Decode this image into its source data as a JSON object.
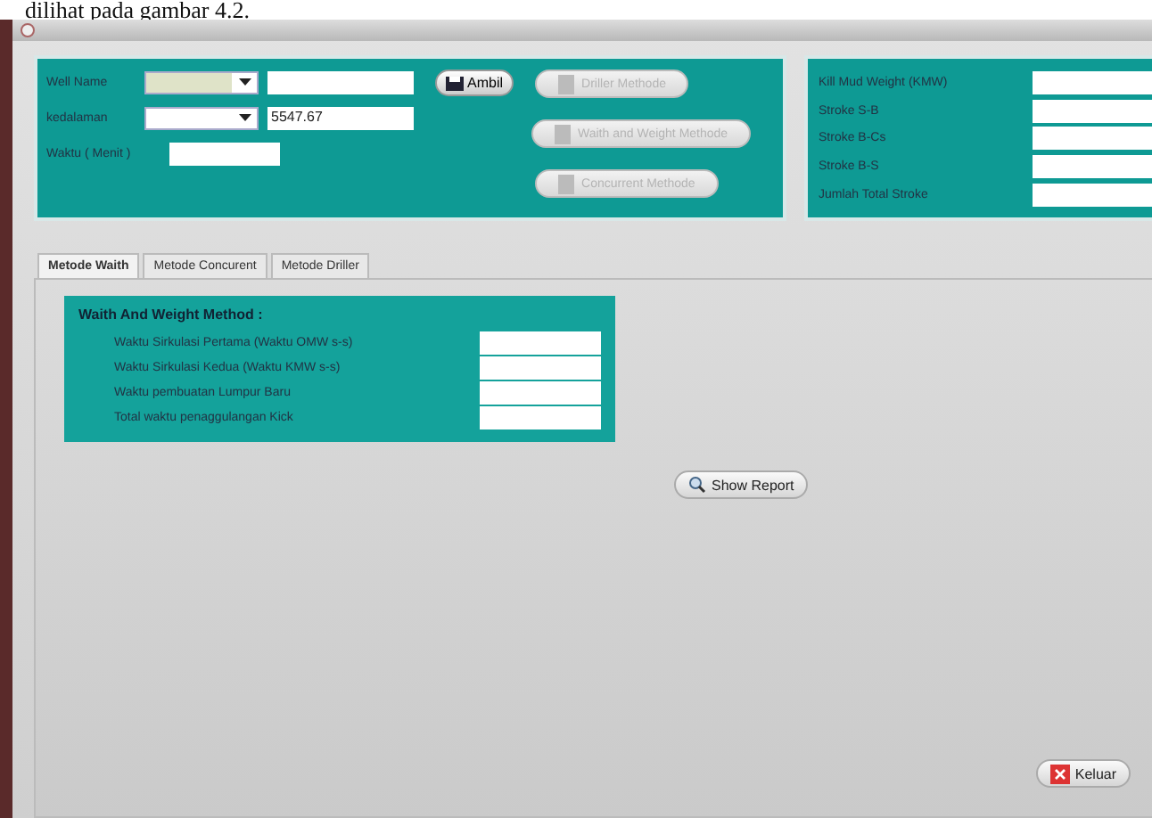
{
  "caption": "dilihat pada gambar 4.2.",
  "input_panel": {
    "rows": [
      {
        "label": "Well Name",
        "kind": "combo",
        "highlighted": true
      },
      {
        "label": "kedalaman",
        "kind": "combo",
        "highlighted": false,
        "value": "5547.67"
      },
      {
        "label": "Waktu ( Menit )",
        "kind": "text"
      }
    ],
    "ambil_button": "Ambil",
    "method_buttons": [
      {
        "label": "Driller Methode",
        "disabled": true
      },
      {
        "label": "Waith and Weight Methode",
        "disabled": true
      },
      {
        "label": "Concurrent Methode",
        "disabled": true
      }
    ]
  },
  "stroke_panel": {
    "rows": [
      "Kill Mud Weight (KMW)",
      "Stroke S-B",
      "Stroke B-Cs",
      "Stroke B-S",
      "Jumlah Total Stroke"
    ]
  },
  "tabs": [
    {
      "label": "Metode Waith",
      "selected": true
    },
    {
      "label": "Metode Concurent",
      "selected": false
    },
    {
      "label": "Metode Driller",
      "selected": false
    }
  ],
  "method_box": {
    "title": "Waith And Weight Method :",
    "rows": [
      "Waktu Sirkulasi Pertama (Waktu OMW s-s)",
      "Waktu Sirkulasi Kedua (Waktu KMW s-s)",
      "Waktu pembuatan Lumpur Baru",
      "Total waktu penaggulangan Kick"
    ]
  },
  "show_report_button": "Show Report",
  "exit_button": "Keluar"
}
